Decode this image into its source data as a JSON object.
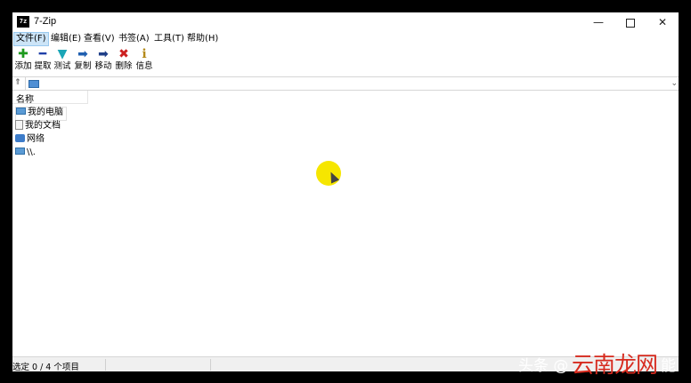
{
  "window": {
    "title": "7-Zip",
    "icon_text": "7z",
    "controls": {
      "minimize": "—",
      "maximize": "",
      "close": "✕"
    }
  },
  "menu": {
    "items": [
      {
        "label": "文件(F)",
        "active": true
      },
      {
        "label": "编辑(E)"
      },
      {
        "label": "查看(V)"
      },
      {
        "label": "书签(A)"
      },
      {
        "label": "工具(T)"
      },
      {
        "label": "帮助(H)"
      }
    ]
  },
  "toolbar": {
    "buttons": [
      {
        "label": "添加",
        "icon": "plus-icon",
        "glyph": "✚",
        "color": "#1e9a1e"
      },
      {
        "label": "提取",
        "icon": "minus-icon",
        "glyph": "━",
        "color": "#1f3fa8"
      },
      {
        "label": "测试",
        "icon": "check-icon",
        "glyph": "▼",
        "color": "#1aa6b7"
      },
      {
        "label": "复制",
        "icon": "copy-arrow-icon",
        "glyph": "➡",
        "color": "#1f5fb0"
      },
      {
        "label": "移动",
        "icon": "move-arrow-icon",
        "glyph": "➡",
        "color": "#1f3f88"
      },
      {
        "label": "删除",
        "icon": "delete-icon",
        "glyph": "✖",
        "color": "#cc1f1f"
      },
      {
        "label": "信息",
        "icon": "info-icon",
        "glyph": "ℹ",
        "color": "#b48a1a"
      }
    ]
  },
  "address": {
    "up_glyph": "⇑",
    "value": "",
    "dropdown_glyph": "⌄"
  },
  "list": {
    "columns": [
      {
        "label": "名称"
      }
    ],
    "rows": [
      {
        "label": "我的电脑",
        "icon": "computer-icon",
        "selected": true
      },
      {
        "label": "我的文档",
        "icon": "document-icon"
      },
      {
        "label": "网络",
        "icon": "network-icon"
      },
      {
        "label": "\\\\.",
        "icon": "device-icon"
      }
    ]
  },
  "status": {
    "text": "选定 0 / 4 个项目"
  },
  "watermark": {
    "prefix": "头条 @",
    "brand": "云南龙网",
    "suffix": "能"
  },
  "colors": {
    "cursor_highlight": "#f6e600",
    "menu_active_bg": "#cce4f7",
    "watermark_brand": "#d72b1f"
  }
}
